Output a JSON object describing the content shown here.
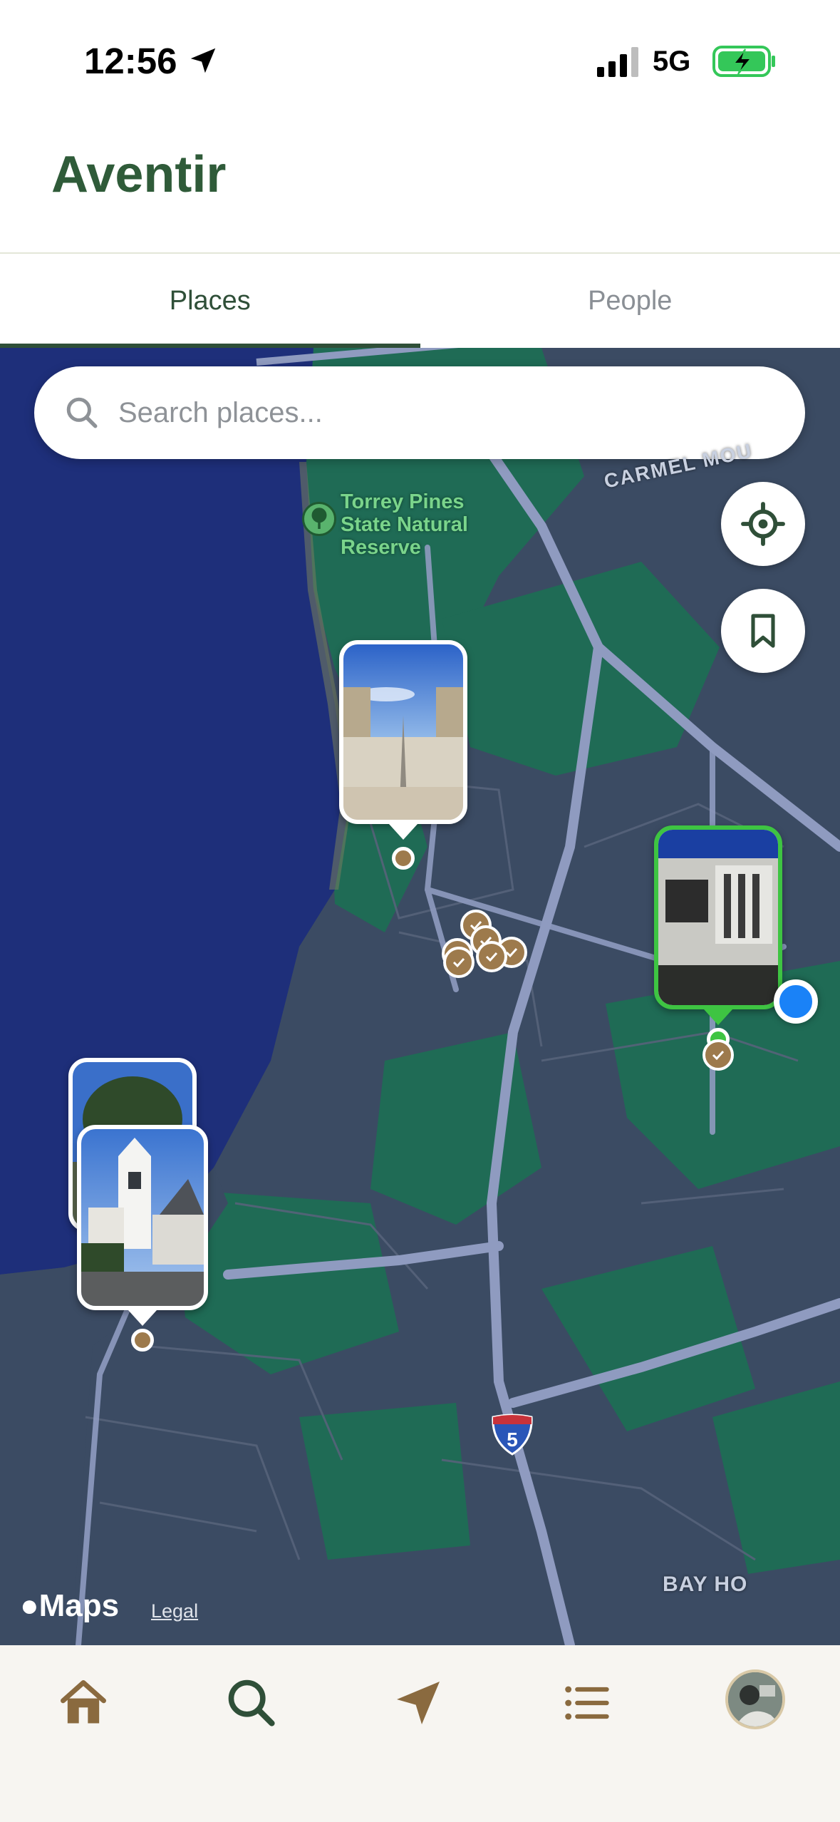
{
  "status_bar": {
    "time": "12:56",
    "network": "5G",
    "icons": [
      "location-arrow-icon",
      "signal-icon",
      "battery-charging-icon"
    ],
    "battery_color": "#34c759"
  },
  "header": {
    "title": "Aventir",
    "title_color": "#2f5b39"
  },
  "tabs": [
    {
      "label": "Places",
      "active": true
    },
    {
      "label": "People",
      "active": false
    }
  ],
  "map": {
    "search": {
      "placeholder": "Search places..."
    },
    "poi_label": "Torrey Pines State Natural Reserve",
    "poi_label_lines": [
      "Torrey Pines",
      "State Natural",
      "Reserve"
    ],
    "road_labels": [
      "CARMEL MOU",
      "BAY HO"
    ],
    "interstate_number": "5",
    "attribution": {
      "logo": "Maps",
      "legal": "Legal"
    },
    "controls": [
      "locate-icon",
      "bookmark-icon"
    ]
  },
  "bottom_nav": [
    {
      "name": "home",
      "icon": "home-icon"
    },
    {
      "name": "search",
      "icon": "search-icon"
    },
    {
      "name": "navigate",
      "icon": "navigation-arrow-icon"
    },
    {
      "name": "list",
      "icon": "list-icon"
    },
    {
      "name": "profile",
      "icon": "avatar"
    }
  ],
  "colors": {
    "accent": "#2f4f38",
    "marker_brown": "#9d7a4c",
    "selected_pin": "#3ec442",
    "user_dot": "#1a82f7",
    "ocean": "#1e2f7a",
    "land": "#3b4b63",
    "park": "#1f6b55"
  }
}
